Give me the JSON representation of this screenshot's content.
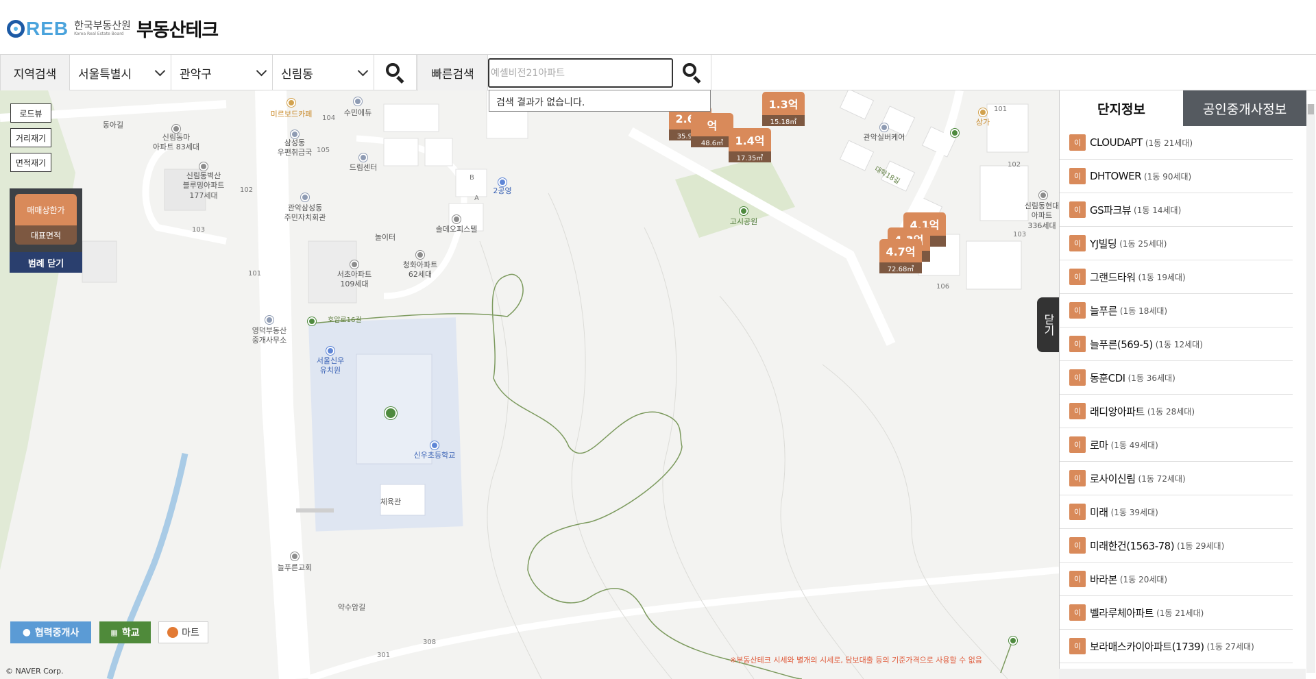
{
  "header": {
    "logo_mark": "REB",
    "org_name": "한국부동산원",
    "org_name_en": "Korea Real Estate Board",
    "site_title": "부동산테크"
  },
  "search": {
    "region_label": "지역검색",
    "city": "서울특별시",
    "district": "관악구",
    "dong": "신림동",
    "quick_label": "빠른검색",
    "quick_placeholder": "예셀비전21아파트",
    "no_result": "검색 결과가 없습니다."
  },
  "map_controls": {
    "roadview": "로드뷰",
    "distance": "거리재기",
    "area": "면적재기",
    "legend_price": "매매상한가",
    "legend_area": "대표면적",
    "legend_close": "범례 닫기"
  },
  "bottom_buttons": {
    "agents": "협력중개사",
    "school": "학교",
    "mart": "마트"
  },
  "notice": "※부동산테크 시세와 별개의 시세로, 담보대출 등의 기준가격으로 사용할 수 없음",
  "copyright": "© NAVER Corp.",
  "map_labels": {
    "l1": "동아길",
    "l2": "신림동마\n아파트 83세대",
    "l3": "신림동벽산\n블루밍아파트\n177세대",
    "l4": "미르보드카페",
    "l5": "수민에듀",
    "l6": "삼성동\n우편취급국",
    "l7": "드림센터",
    "l8": "관악삼성동\n주민자치회관",
    "l9": "놀이터",
    "l10": "솔데오피스텔",
    "l11": "2공영",
    "l12": "서초아파트\n109세대",
    "l13": "청화아파트\n62세대",
    "l14": "영덕부동산\n중개사무소",
    "l15": "호암로16길",
    "l16": "서울신우\n유치원",
    "l17": "신우초등학교",
    "l18": "체육관",
    "l19": "늘푸른교회",
    "l20": "약수암길",
    "l21": "고시공원",
    "l22": "관악실버케어",
    "l23": "상가",
    "l24": "대학18길",
    "l25": "신림동현대\n아파트\n336세대"
  },
  "building_numbers": [
    "104",
    "105",
    "102",
    "103",
    "101",
    "301",
    "308",
    "101",
    "102",
    "103",
    "106",
    "B",
    "A"
  ],
  "price_markers": [
    {
      "price": "2.6억",
      "area": "35.94㎡"
    },
    {
      "price": "억",
      "area": "48.6㎡"
    },
    {
      "price": "1.4억",
      "area": "17.35㎡"
    },
    {
      "price": "1.3억",
      "area": "15.18㎡"
    },
    {
      "price": "4.1억",
      "area": "㎡"
    },
    {
      "price": "4.3억",
      "area": "㎡"
    },
    {
      "price": "4.7억",
      "area": "72.68㎡"
    }
  ],
  "panel": {
    "tab_complex": "단지정보",
    "tab_agent": "공인중개사정보",
    "close_tab": "닫기",
    "tag": "이",
    "items": [
      {
        "name": "CLOUDAPT",
        "count": "(1동 21세대)"
      },
      {
        "name": "DHTOWER",
        "count": "(1동 90세대)"
      },
      {
        "name": "GS파크뷰",
        "count": "(1동 14세대)"
      },
      {
        "name": "YJ빌딩",
        "count": "(1동 25세대)"
      },
      {
        "name": "그랜드타워",
        "count": "(1동 19세대)"
      },
      {
        "name": "늘푸른",
        "count": "(1동 18세대)"
      },
      {
        "name": "늘푸른(569-5)",
        "count": "(1동 12세대)"
      },
      {
        "name": "동훈CDI",
        "count": "(1동 36세대)"
      },
      {
        "name": "래디앙아파트",
        "count": "(1동 28세대)"
      },
      {
        "name": "로마",
        "count": "(1동 49세대)"
      },
      {
        "name": "로사이신림",
        "count": "(1동 72세대)"
      },
      {
        "name": "미래",
        "count": "(1동 39세대)"
      },
      {
        "name": "미래한건(1563-78)",
        "count": "(1동 29세대)"
      },
      {
        "name": "바라본",
        "count": "(1동 20세대)"
      },
      {
        "name": "벨라루체아파트",
        "count": "(1동 21세대)"
      },
      {
        "name": "보라매스카이아파트(1739)",
        "count": "(1동 27세대)"
      }
    ]
  },
  "colors": {
    "price": "#d98a5a",
    "area": "#7d5841",
    "legend_close": "#2a3f6e",
    "agent_btn": "#5b9bd5",
    "school_btn": "#4f8a3a"
  }
}
